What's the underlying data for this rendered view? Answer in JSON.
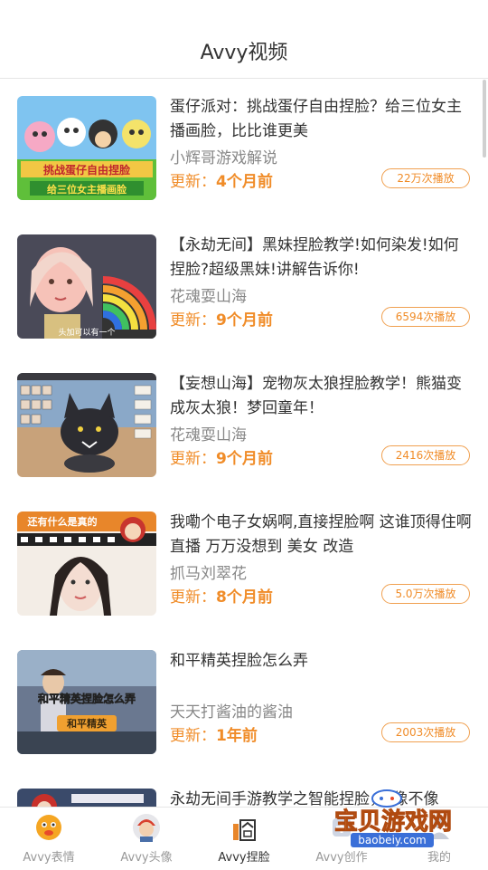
{
  "header": {
    "title": "Avvy视频"
  },
  "videos": [
    {
      "title": "蛋仔派对：挑战蛋仔自由捏脸？给三位女主播画脸，比比谁更美",
      "author": "小辉哥游戏解说",
      "updated_label": "更新：",
      "updated_value": "4个月前",
      "plays": "22万次播放",
      "thumb_text_1": "挑战蛋仔自由捏脸",
      "thumb_text_2": "给三位女主播画脸"
    },
    {
      "title": "【永劫无间】黑妹捏脸教学!如何染发!如何捏脸?超级黑妹!讲解告诉你!",
      "author": "花魂耍山海",
      "updated_label": "更新：",
      "updated_value": "9个月前",
      "plays": "6594次播放",
      "thumb_caption": "头加可以有一个"
    },
    {
      "title": "【妄想山海】宠物灰太狼捏脸教学！熊猫变成灰太狼！梦回童年！",
      "author": "花魂耍山海",
      "updated_label": "更新：",
      "updated_value": "9个月前",
      "plays": "2416次播放"
    },
    {
      "title": "我嘞个电子女娲啊,直接捏脸啊 这谁顶得住啊直播 万万没想到 美女 改造",
      "author": "抓马刘翠花",
      "updated_label": "更新：",
      "updated_value": "8个月前",
      "plays": "5.0万次播放",
      "thumb_banner": "还有什么是真的"
    },
    {
      "title": "和平精英捏脸怎么弄",
      "author": "天天打酱油的酱油",
      "updated_label": "更新：",
      "updated_value": "1年前",
      "plays": "2003次播放",
      "thumb_text_1": "和平精英捏脸怎么弄",
      "thumb_text_2": "和平精英"
    },
    {
      "title": "永劫无间手游教学之智能捏脸，　像不像",
      "author": "",
      "updated_label": "",
      "updated_value": "",
      "plays": ""
    }
  ],
  "tabs": [
    {
      "label": "Avvy表情",
      "icon": "emoji-face-icon",
      "active": false
    },
    {
      "label": "Avvy头像",
      "icon": "avatar-icon",
      "active": false
    },
    {
      "label": "Avvy捏脸",
      "icon": "face-sculpt-icon",
      "active": true
    },
    {
      "label": "Avvy创作",
      "icon": "create-icon",
      "active": false
    },
    {
      "label": "我的",
      "icon": "profile-icon",
      "active": false
    }
  ],
  "watermark": {
    "text": "宝贝游戏网",
    "url": "baobeiy.com"
  },
  "colors": {
    "accent": "#f08c28",
    "divider": "#eeeeee"
  }
}
